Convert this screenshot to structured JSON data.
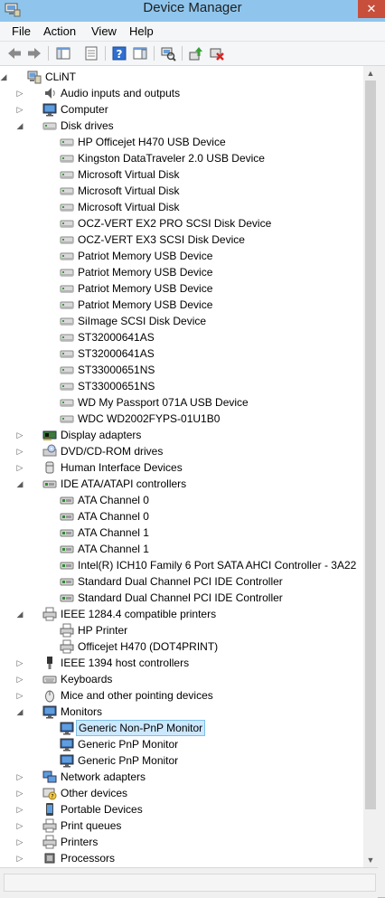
{
  "window": {
    "title": "Device Manager",
    "close_glyph": "✕"
  },
  "menu": [
    "File",
    "Action",
    "View",
    "Help"
  ],
  "toolbar_icons": [
    "back-arrow-icon",
    "forward-arrow-icon",
    "show-hide-console-tree-icon",
    "properties-icon",
    "help-icon",
    "action-pane-icon",
    "scan-hardware-icon",
    "update-driver-icon",
    "uninstall-device-icon"
  ],
  "colors": {
    "titlebar": "#8fc5ec",
    "close": "#c74f3c",
    "selection": "#cce8ff",
    "selection_border": "#7dc0ea"
  },
  "tree": [
    {
      "label": "CLiNT",
      "level": 0,
      "icon": "computer-icon",
      "exp": "open"
    },
    {
      "label": "Audio inputs and outputs",
      "level": 1,
      "icon": "speaker-icon",
      "exp": "closed"
    },
    {
      "label": "Computer",
      "level": 1,
      "icon": "monitor-icon",
      "exp": "closed"
    },
    {
      "label": "Disk drives",
      "level": 1,
      "icon": "disk-icon",
      "exp": "open"
    },
    {
      "label": "HP Officejet H470 USB Device",
      "level": 2,
      "icon": "disk-icon"
    },
    {
      "label": "Kingston DataTraveler 2.0 USB Device",
      "level": 2,
      "icon": "disk-icon"
    },
    {
      "label": "Microsoft Virtual Disk",
      "level": 2,
      "icon": "disk-icon"
    },
    {
      "label": "Microsoft Virtual Disk",
      "level": 2,
      "icon": "disk-icon"
    },
    {
      "label": "Microsoft Virtual Disk",
      "level": 2,
      "icon": "disk-icon"
    },
    {
      "label": "OCZ-VERT EX2 PRO SCSI Disk Device",
      "level": 2,
      "icon": "disk-icon"
    },
    {
      "label": "OCZ-VERT EX3 SCSI Disk Device",
      "level": 2,
      "icon": "disk-icon"
    },
    {
      "label": "Patriot Memory USB Device",
      "level": 2,
      "icon": "disk-icon"
    },
    {
      "label": "Patriot Memory USB Device",
      "level": 2,
      "icon": "disk-icon"
    },
    {
      "label": "Patriot Memory USB Device",
      "level": 2,
      "icon": "disk-icon"
    },
    {
      "label": "Patriot Memory USB Device",
      "level": 2,
      "icon": "disk-icon"
    },
    {
      "label": "SiImage  SCSI Disk Device",
      "level": 2,
      "icon": "disk-icon"
    },
    {
      "label": "ST32000641AS",
      "level": 2,
      "icon": "disk-icon"
    },
    {
      "label": "ST32000641AS",
      "level": 2,
      "icon": "disk-icon"
    },
    {
      "label": "ST33000651NS",
      "level": 2,
      "icon": "disk-icon"
    },
    {
      "label": "ST33000651NS",
      "level": 2,
      "icon": "disk-icon"
    },
    {
      "label": "WD My Passport 071A USB Device",
      "level": 2,
      "icon": "disk-icon"
    },
    {
      "label": "WDC WD2002FYPS-01U1B0",
      "level": 2,
      "icon": "disk-icon"
    },
    {
      "label": "Display adapters",
      "level": 1,
      "icon": "display-adapter-icon",
      "exp": "closed"
    },
    {
      "label": "DVD/CD-ROM drives",
      "level": 1,
      "icon": "dvd-icon",
      "exp": "closed"
    },
    {
      "label": "Human Interface Devices",
      "level": 1,
      "icon": "hid-icon",
      "exp": "closed"
    },
    {
      "label": "IDE ATA/ATAPI controllers",
      "level": 1,
      "icon": "controller-icon",
      "exp": "open"
    },
    {
      "label": "ATA Channel 0",
      "level": 2,
      "icon": "controller-icon"
    },
    {
      "label": "ATA Channel 0",
      "level": 2,
      "icon": "controller-icon"
    },
    {
      "label": "ATA Channel 1",
      "level": 2,
      "icon": "controller-icon"
    },
    {
      "label": "ATA Channel 1",
      "level": 2,
      "icon": "controller-icon"
    },
    {
      "label": "Intel(R) ICH10 Family 6 Port SATA AHCI Controller - 3A22",
      "level": 2,
      "icon": "controller-icon"
    },
    {
      "label": "Standard Dual Channel PCI IDE Controller",
      "level": 2,
      "icon": "controller-icon"
    },
    {
      "label": "Standard Dual Channel PCI IDE Controller",
      "level": 2,
      "icon": "controller-icon"
    },
    {
      "label": "IEEE 1284.4 compatible printers",
      "level": 1,
      "icon": "printer-icon",
      "exp": "open"
    },
    {
      "label": "HP Printer",
      "level": 2,
      "icon": "printer-icon"
    },
    {
      "label": "Officejet H470 (DOT4PRINT)",
      "level": 2,
      "icon": "printer-icon"
    },
    {
      "label": "IEEE 1394 host controllers",
      "level": 1,
      "icon": "firewire-icon",
      "exp": "closed"
    },
    {
      "label": "Keyboards",
      "level": 1,
      "icon": "keyboard-icon",
      "exp": "closed"
    },
    {
      "label": "Mice and other pointing devices",
      "level": 1,
      "icon": "mouse-icon",
      "exp": "closed"
    },
    {
      "label": "Monitors",
      "level": 1,
      "icon": "monitor-icon",
      "exp": "open"
    },
    {
      "label": "Generic Non-PnP Monitor",
      "level": 2,
      "icon": "monitor-icon",
      "selected": true
    },
    {
      "label": "Generic PnP Monitor",
      "level": 2,
      "icon": "monitor-icon"
    },
    {
      "label": "Generic PnP Monitor",
      "level": 2,
      "icon": "monitor-icon"
    },
    {
      "label": "Network adapters",
      "level": 1,
      "icon": "network-icon",
      "exp": "closed"
    },
    {
      "label": "Other devices",
      "level": 1,
      "icon": "other-devices-icon",
      "exp": "closed"
    },
    {
      "label": "Portable Devices",
      "level": 1,
      "icon": "portable-device-icon",
      "exp": "closed"
    },
    {
      "label": "Print queues",
      "level": 1,
      "icon": "printer-icon",
      "exp": "closed"
    },
    {
      "label": "Printers",
      "level": 1,
      "icon": "printer-icon",
      "exp": "closed"
    },
    {
      "label": "Processors",
      "level": 1,
      "icon": "processor-icon",
      "exp": "closed"
    }
  ]
}
